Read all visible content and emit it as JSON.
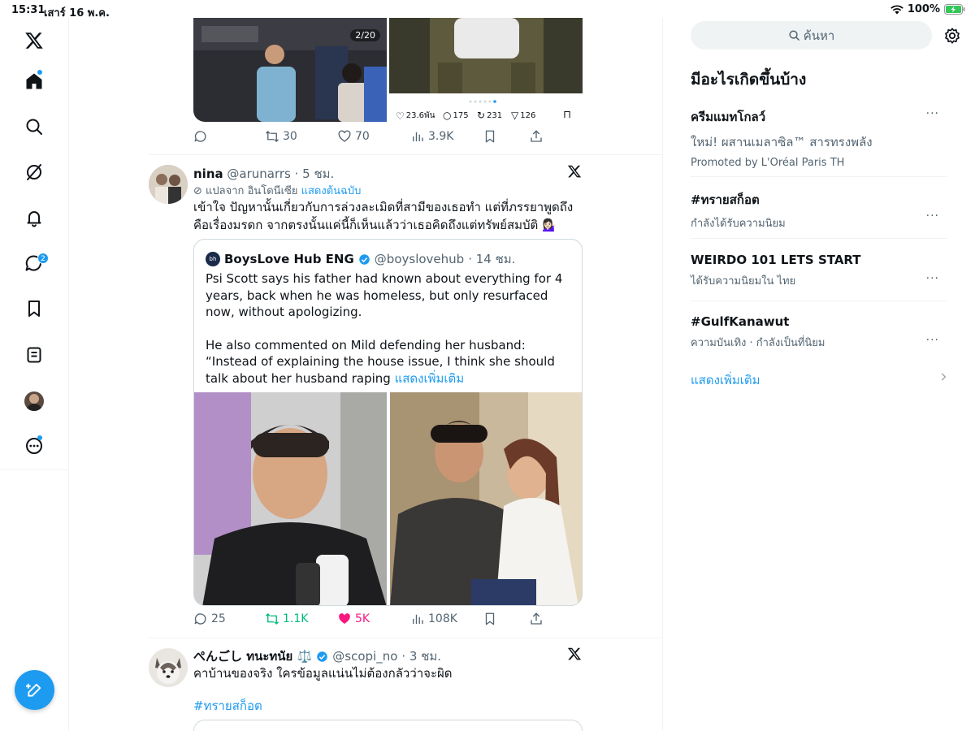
{
  "status_bar": {
    "time": "15:31",
    "date": "เสาร์ 16 พ.ค.",
    "battery": "100%"
  },
  "sidebar": {
    "icons": [
      "x-logo-icon",
      "home-icon",
      "search-icon",
      "grok-icon",
      "notifications-icon",
      "messages-icon",
      "bookmarks-icon",
      "lists-icon",
      "profile-avatar",
      "more-icon"
    ],
    "messages_badge": "2",
    "compose": "compose-icon"
  },
  "feed": {
    "prev_tweet": {
      "photo_counter": "2/20",
      "inner_stats": {
        "likes": "23.6พัน",
        "replies": "175",
        "reposts": "231",
        "shares": "126"
      },
      "actions": {
        "reposts": "30",
        "likes": "70",
        "views": "3.9K"
      }
    },
    "tweet1": {
      "name": "nina",
      "handle": "@arunarrs",
      "time": "· 5 ชม.",
      "translated_from": "แปลจาก อินโดนีเซีย",
      "show_original": "แสดงต้นฉบับ",
      "text": "เข้าใจ ปัญหานั้นเกี่ยวกับการล่วงละเมิดที่สามีของเธอทำ แต่ที่ภรรยาพูดถึงคือเรื่องมรดก จากตรงนั้นแค่นี้ก็เห็นแล้วว่าเธอคิดถึงแต่ทรัพย์สมบัติ 💁🏻‍♀️",
      "quote": {
        "name": "BoysLove Hub ENG",
        "handle": "@boyslovehub",
        "time": "· 14 ชม.",
        "para1": "Psi Scott says his father had known about everything for 4 years, back when he was homeless, but only resurfaced now, without apologizing.",
        "para2": "He also commented on Mild defending her husband: “Instead of explaining the house issue, I think she should talk about her husband raping",
        "show_more": "แสดงเพิ่มเติม"
      },
      "actions": {
        "replies": "25",
        "reposts": "1.1K",
        "likes": "5K",
        "views": "108K"
      }
    },
    "tweet2": {
      "name": "ぺんごし ทนะทนัย ⚖️",
      "handle": "@scopi_no",
      "time": "· 3 ชม.",
      "text": "คาบ้านของจริง ใครข้อมูลแน่นไม่ต้องกลัวว่าจะผิด",
      "hashtag": "#ทรายสก็อต"
    }
  },
  "right": {
    "search_placeholder": "ค้นหา",
    "trends_title": "มีอะไรเกิดขึ้นบ้าง",
    "trends": [
      {
        "title": "ครีมแมทโกลว์",
        "line2": "ใหม่! ผสานเมลาซิล™ สารทรงพลัง",
        "line3": "Promoted by L'Oréal Paris TH"
      },
      {
        "title": "#ทรายสก็อต",
        "line2": "กำลังได้รับความนิยม"
      },
      {
        "title": "WEIRDO 101 LETS START",
        "line2": "ได้รับความนิยมใน ไทย"
      },
      {
        "title": "#GulfKanawut",
        "line2": "ความบันเทิง · กำลังเป็นที่นิยม"
      }
    ],
    "more_glyph": "···",
    "show_more": "แสดงเพิ่มเติม"
  },
  "colors": {
    "accent": "#1d9bf0",
    "like": "#f91880",
    "repost": "#00ba7c",
    "text": "#0f1419",
    "muted": "#536471"
  }
}
